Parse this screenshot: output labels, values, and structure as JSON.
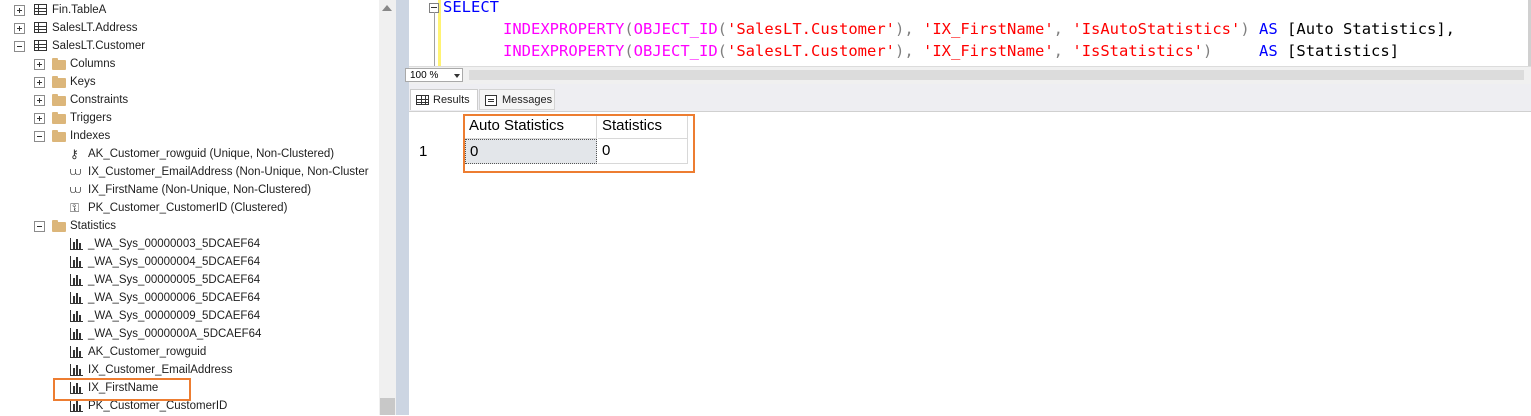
{
  "explorer": {
    "items": [
      {
        "label": "Fin.TableA",
        "expander": "plus",
        "icon": "table"
      },
      {
        "label": "SalesLT.Address",
        "expander": "plus",
        "icon": "table"
      },
      {
        "label": "SalesLT.Customer",
        "expander": "minus",
        "icon": "table"
      },
      {
        "label": "Columns",
        "expander": "plus",
        "icon": "folder"
      },
      {
        "label": "Keys",
        "expander": "plus",
        "icon": "folder"
      },
      {
        "label": "Constraints",
        "expander": "plus",
        "icon": "folder"
      },
      {
        "label": "Triggers",
        "expander": "plus",
        "icon": "folder"
      },
      {
        "label": "Indexes",
        "expander": "minus",
        "icon": "folder"
      },
      {
        "label": "AK_Customer_rowguid (Unique, Non-Clustered)",
        "icon": "key"
      },
      {
        "label": "IX_Customer_EmailAddress (Non-Unique, Non-Cluster",
        "icon": "index"
      },
      {
        "label": "IX_FirstName (Non-Unique, Non-Clustered)",
        "icon": "index"
      },
      {
        "label": "PK_Customer_CustomerID (Clustered)",
        "icon": "pk"
      },
      {
        "label": "Statistics",
        "expander": "minus",
        "icon": "folder"
      },
      {
        "label": "_WA_Sys_00000003_5DCAEF64",
        "icon": "statistics"
      },
      {
        "label": "_WA_Sys_00000004_5DCAEF64",
        "icon": "statistics"
      },
      {
        "label": "_WA_Sys_00000005_5DCAEF64",
        "icon": "statistics"
      },
      {
        "label": "_WA_Sys_00000006_5DCAEF64",
        "icon": "statistics"
      },
      {
        "label": "_WA_Sys_00000009_5DCAEF64",
        "icon": "statistics"
      },
      {
        "label": "_WA_Sys_0000000A_5DCAEF64",
        "icon": "statistics"
      },
      {
        "label": "AK_Customer_rowguid",
        "icon": "statistics"
      },
      {
        "label": "IX_Customer_EmailAddress",
        "icon": "statistics"
      },
      {
        "label": "IX_FirstName",
        "icon": "statistics"
      },
      {
        "label": "PK_Customer_CustomerID",
        "icon": "statistics"
      }
    ]
  },
  "editor": {
    "line1": {
      "kw": "SELECT"
    },
    "line2": {
      "fn1": "INDEXPROPERTY",
      "p1": "(",
      "fn2": "OBJECT_ID",
      "p2": "(",
      "s1": "'SalesLT.Customer'",
      "p3": "),",
      "s2": "'IX_FirstName'",
      "p4": ",",
      "s3": "'IsAutoStatistics'",
      "p5": ")",
      "as": "AS",
      "alias": "[Auto Statistics],"
    },
    "line3": {
      "fn1": "INDEXPROPERTY",
      "p1": "(",
      "fn2": "OBJECT_ID",
      "p2": "(",
      "s1": "'SalesLT.Customer'",
      "p3": "),",
      "s2": "'IX_FirstName'",
      "p4": ",",
      "s3": "'IsStatistics'",
      "p5": ")",
      "as": "AS",
      "alias": "[Statistics]"
    }
  },
  "zoom": {
    "value": "100 %"
  },
  "result_tabs": {
    "results": "Results",
    "messages": "Messages"
  },
  "results": {
    "columns": [
      "Auto Statistics",
      "Statistics"
    ],
    "rows": [
      {
        "num": "1",
        "cells": [
          "0",
          "0"
        ]
      }
    ]
  },
  "colors": {
    "highlight": "#ed7d31",
    "keyword": "#0000ff",
    "function": "#ff00ff",
    "string": "#ff0000"
  }
}
